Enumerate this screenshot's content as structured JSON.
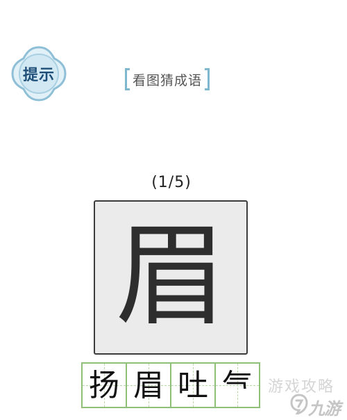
{
  "hint": {
    "label": "提示",
    "icon": "ornate-badge-icon",
    "colors": {
      "fill": "#d7ecf6",
      "ring": "#8fbfd6",
      "text": "#1f4f78"
    }
  },
  "title": {
    "text": "看图猜成语",
    "bracket_color": "#7fb7cf"
  },
  "progress": "(1/5)",
  "puzzle": {
    "character": "眉",
    "card_background": "#ebebeb"
  },
  "answer": {
    "cells": [
      "扬",
      "眉",
      "吐",
      "气"
    ],
    "grid_color": "#8fbf78"
  },
  "watermark": {
    "text": "游戏攻略",
    "logo_text": "九游",
    "logo_icon": "jiuyou-logo-icon"
  }
}
